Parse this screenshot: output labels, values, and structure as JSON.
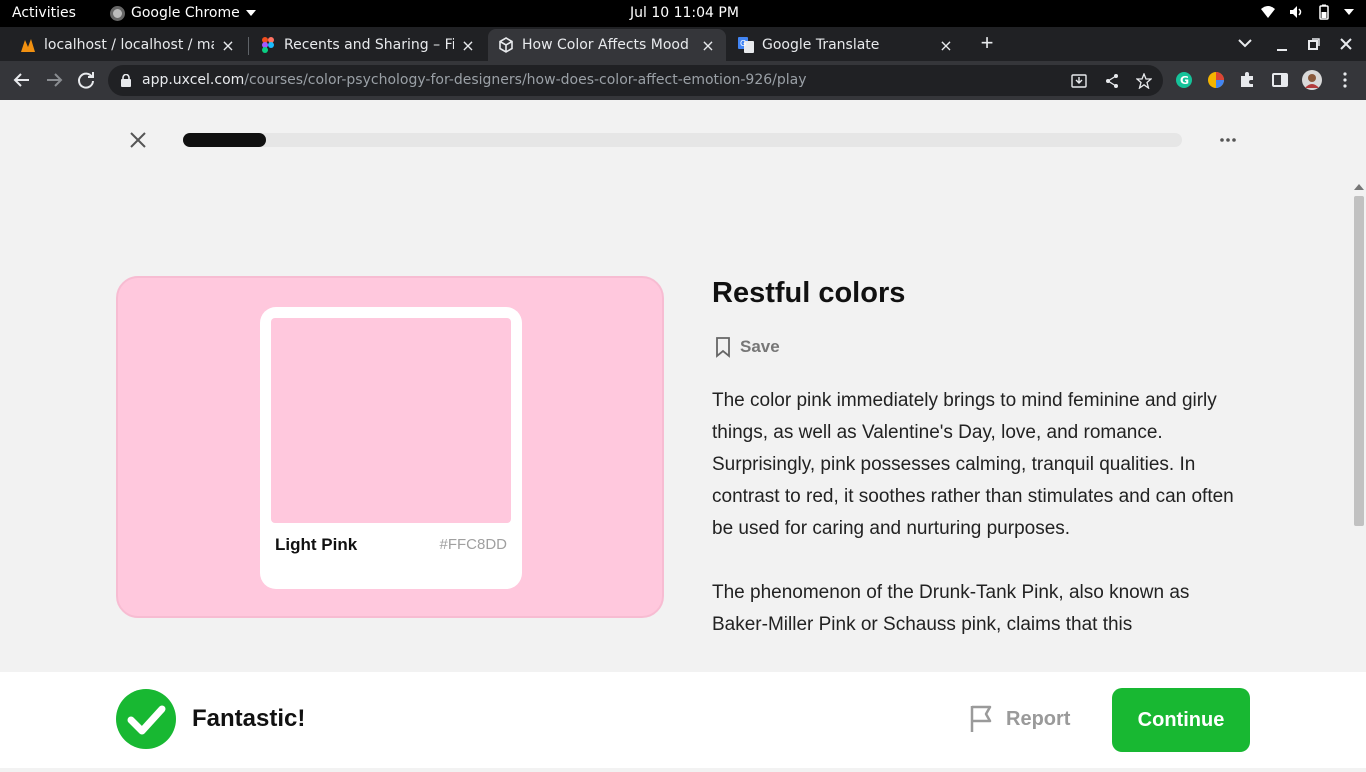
{
  "system": {
    "activities": "Activities",
    "app_name": "Google Chrome",
    "clock": "Jul 10  11:04 PM"
  },
  "browser": {
    "tabs": [
      {
        "title": "localhost / localhost / mar"
      },
      {
        "title": "Recents and Sharing – Fig"
      },
      {
        "title": "How Color Affects Mood ("
      },
      {
        "title": "Google Translate"
      }
    ],
    "url_host": "app.uxcel.com",
    "url_path": "/courses/color-psychology-for-designers/how-does-color-affect-emotion-926/play"
  },
  "lesson": {
    "progress_fraction": 0.083,
    "swatch": {
      "name": "Light Pink",
      "hex": "#FFC8DD",
      "color": "#ffc8dd"
    },
    "title": "Restful colors",
    "save_label": "Save",
    "paragraph_1": "The color pink immediately brings to mind feminine and girly things, as well as Valentine's Day, love, and romance. Surprisingly, pink possesses calming, tranquil qualities. In contrast to red, it soothes rather than stimulates and can often be used for caring and nurturing purposes.",
    "paragraph_2": "The phenomenon of the Drunk-Tank Pink, also known as Baker-Miller Pink or Schauss pink, claims that this"
  },
  "feedback": {
    "message": "Fantastic!",
    "report_label": "Report",
    "continue_label": "Continue",
    "success_color": "#18b832"
  },
  "icons": [
    "chrome-icon",
    "wifi-icon",
    "volume-icon",
    "battery-icon",
    "back-icon",
    "forward-icon",
    "reload-icon",
    "lock-icon",
    "install-icon",
    "share-icon",
    "star-icon",
    "grammarly-icon",
    "extension-icon",
    "puzzle-icon",
    "sidepanel-icon",
    "avatar-icon",
    "close-icon",
    "more-icon",
    "bookmark-icon",
    "check-icon",
    "flag-icon"
  ]
}
